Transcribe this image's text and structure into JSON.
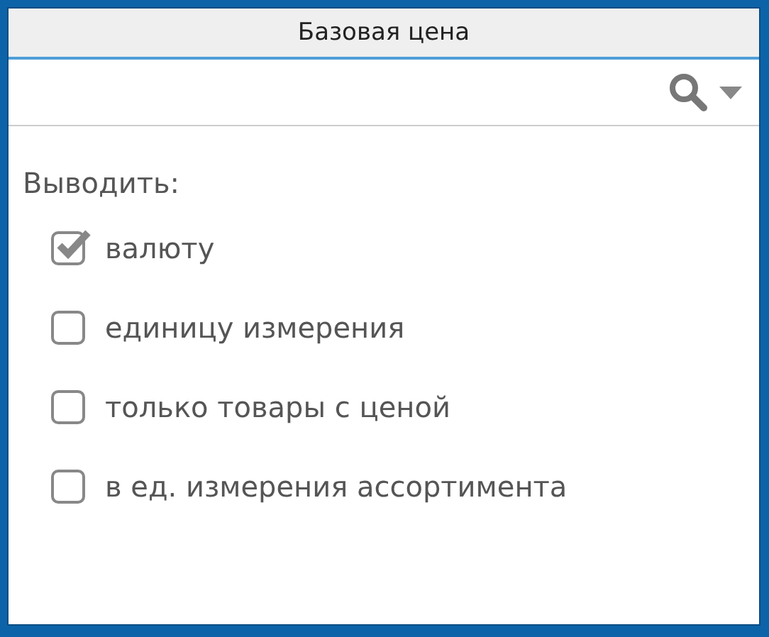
{
  "header": {
    "title": "Базовая цена"
  },
  "label": "Выводить:",
  "options": [
    {
      "label": "валюту",
      "checked": true
    },
    {
      "label": "единицу измерения",
      "checked": false
    },
    {
      "label": "только товары с ценой",
      "checked": false
    },
    {
      "label": "в ед. измерения ассортимента",
      "checked": false
    }
  ]
}
